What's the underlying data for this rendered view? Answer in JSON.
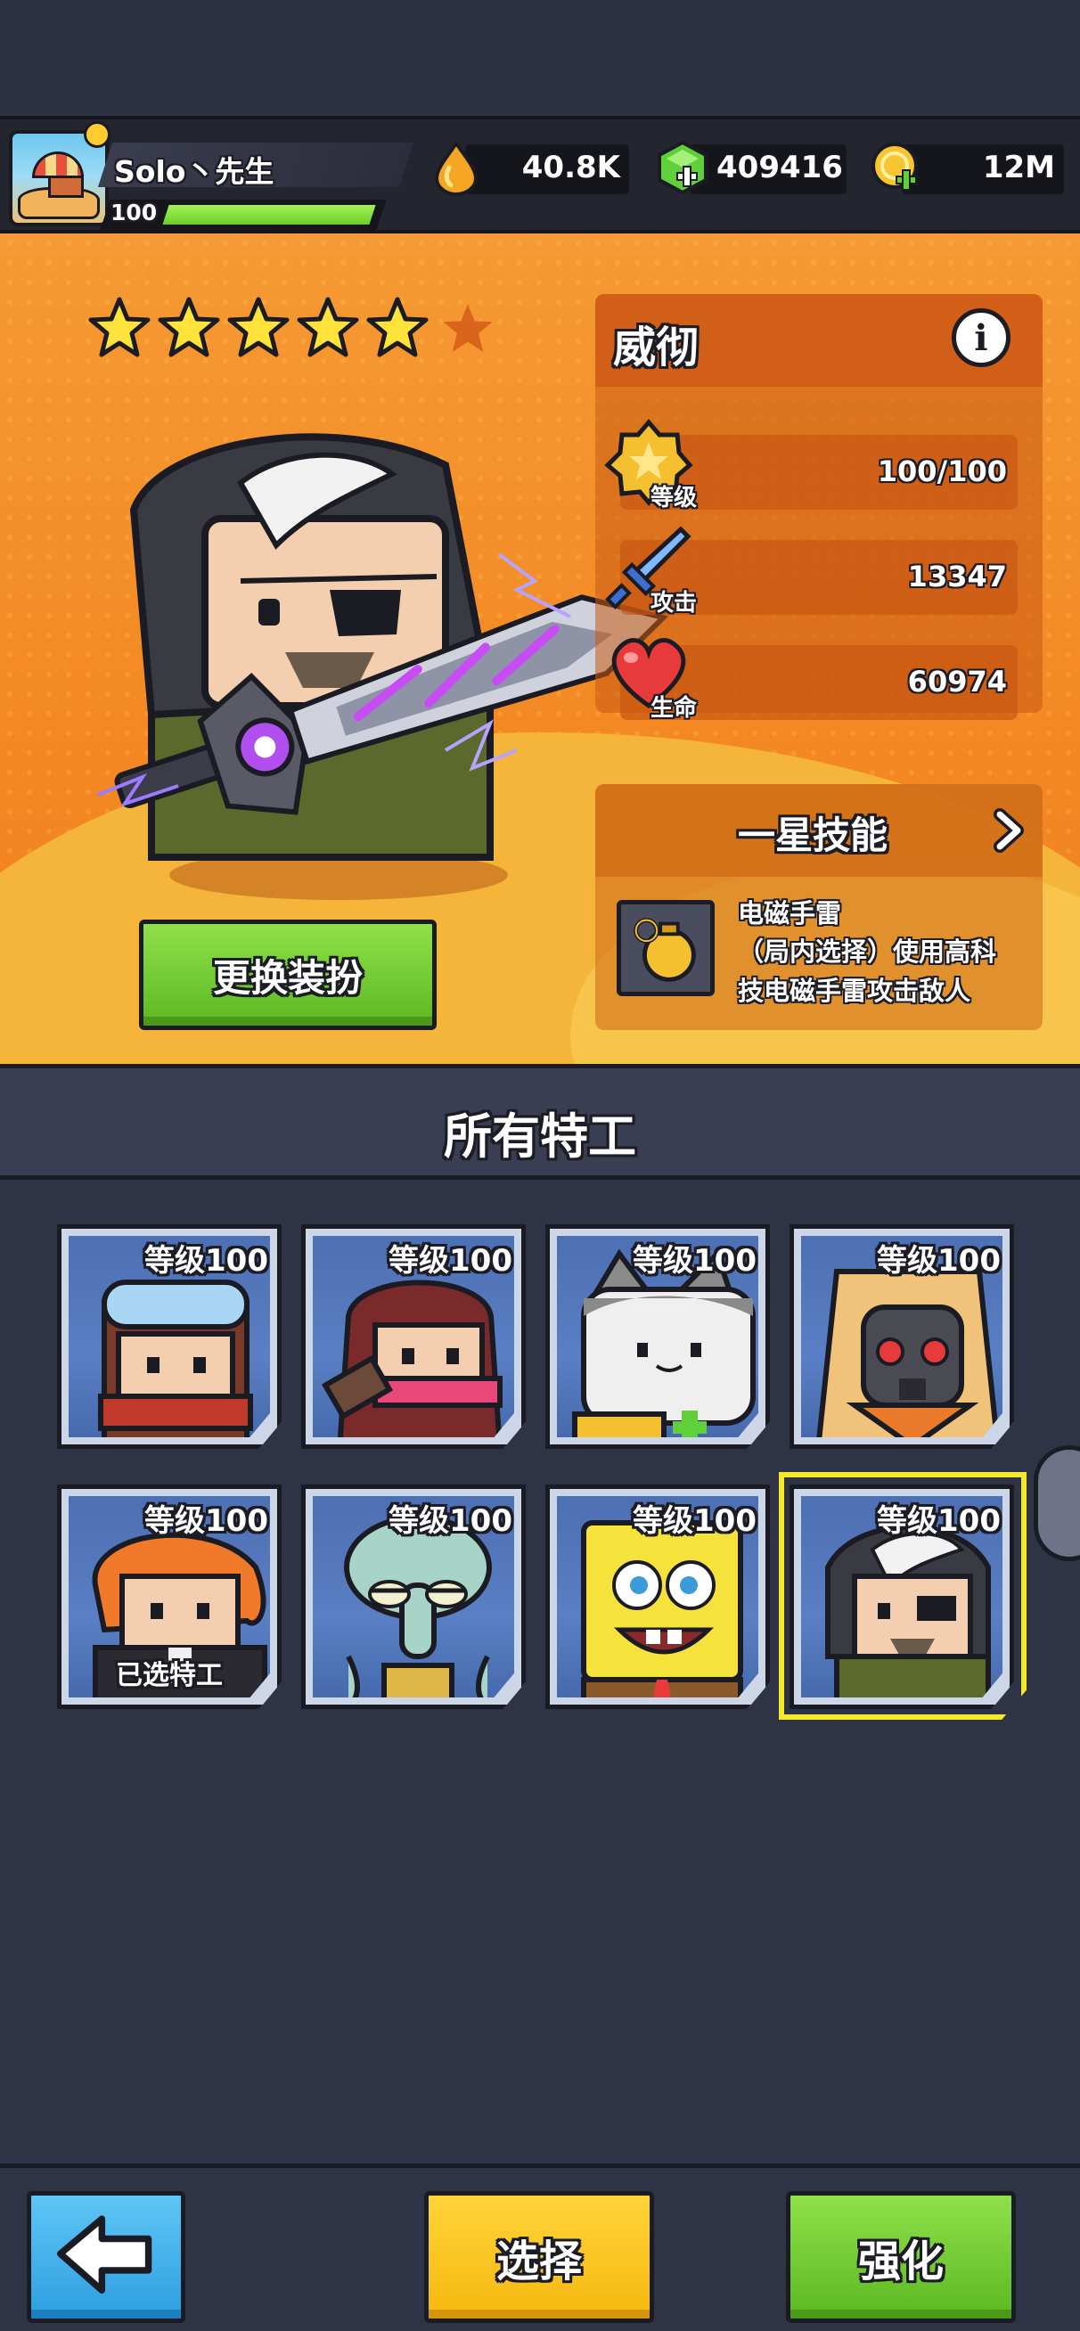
{
  "header": {
    "player_name": "Solo丶先生",
    "player_level": "100",
    "level_progress": 1.0,
    "currencies": [
      {
        "icon": "oil-drop-icon",
        "value": "40.8K"
      },
      {
        "icon": "green-gem-icon",
        "value": "409416"
      },
      {
        "icon": "gold-coin-icon",
        "value": "12M"
      }
    ]
  },
  "hero": {
    "stars_filled": 5,
    "stars_total": 6,
    "name": "威彻",
    "outfit_button": "更换装扮",
    "stats": [
      {
        "icon": "level-badge-icon",
        "label": "等级",
        "value": "100/100"
      },
      {
        "icon": "sword-icon",
        "label": "攻击",
        "value": "13347"
      },
      {
        "icon": "heart-icon",
        "label": "生命",
        "value": "60974"
      }
    ],
    "skill": {
      "title": "一星技能",
      "name": "电磁手雷",
      "description": "（局内选择）使用高科技电磁手雷攻击敌人",
      "desc_line1": "（局内选择）使用高科",
      "desc_line2": "技电磁手雷攻击敌人"
    }
  },
  "roster": {
    "title": "所有特工",
    "agents": [
      {
        "level_label": "等级100",
        "portrait": "goggles-agent"
      },
      {
        "level_label": "等级100",
        "portrait": "red-hair-agent"
      },
      {
        "level_label": "等级100",
        "portrait": "cat-agent"
      },
      {
        "level_label": "等级100",
        "portrait": "gasmask-agent"
      },
      {
        "level_label": "等级100",
        "portrait": "orange-hair-agent",
        "selected_label": "已选特工"
      },
      {
        "level_label": "等级100",
        "portrait": "squidward-agent"
      },
      {
        "level_label": "等级100",
        "portrait": "spongebob-agent"
      },
      {
        "level_label": "等级100",
        "portrait": "eyepatch-agent",
        "highlighted": true
      }
    ]
  },
  "footer": {
    "back_icon": "back-arrow-icon",
    "select_label": "选择",
    "upgrade_label": "强化"
  },
  "colors": {
    "accent_green": "#6ccf26",
    "accent_yellow": "#f5b80f",
    "accent_blue": "#2e9ee0",
    "panel_orange": "#f48a24",
    "highlight": "#f4ea2a"
  }
}
